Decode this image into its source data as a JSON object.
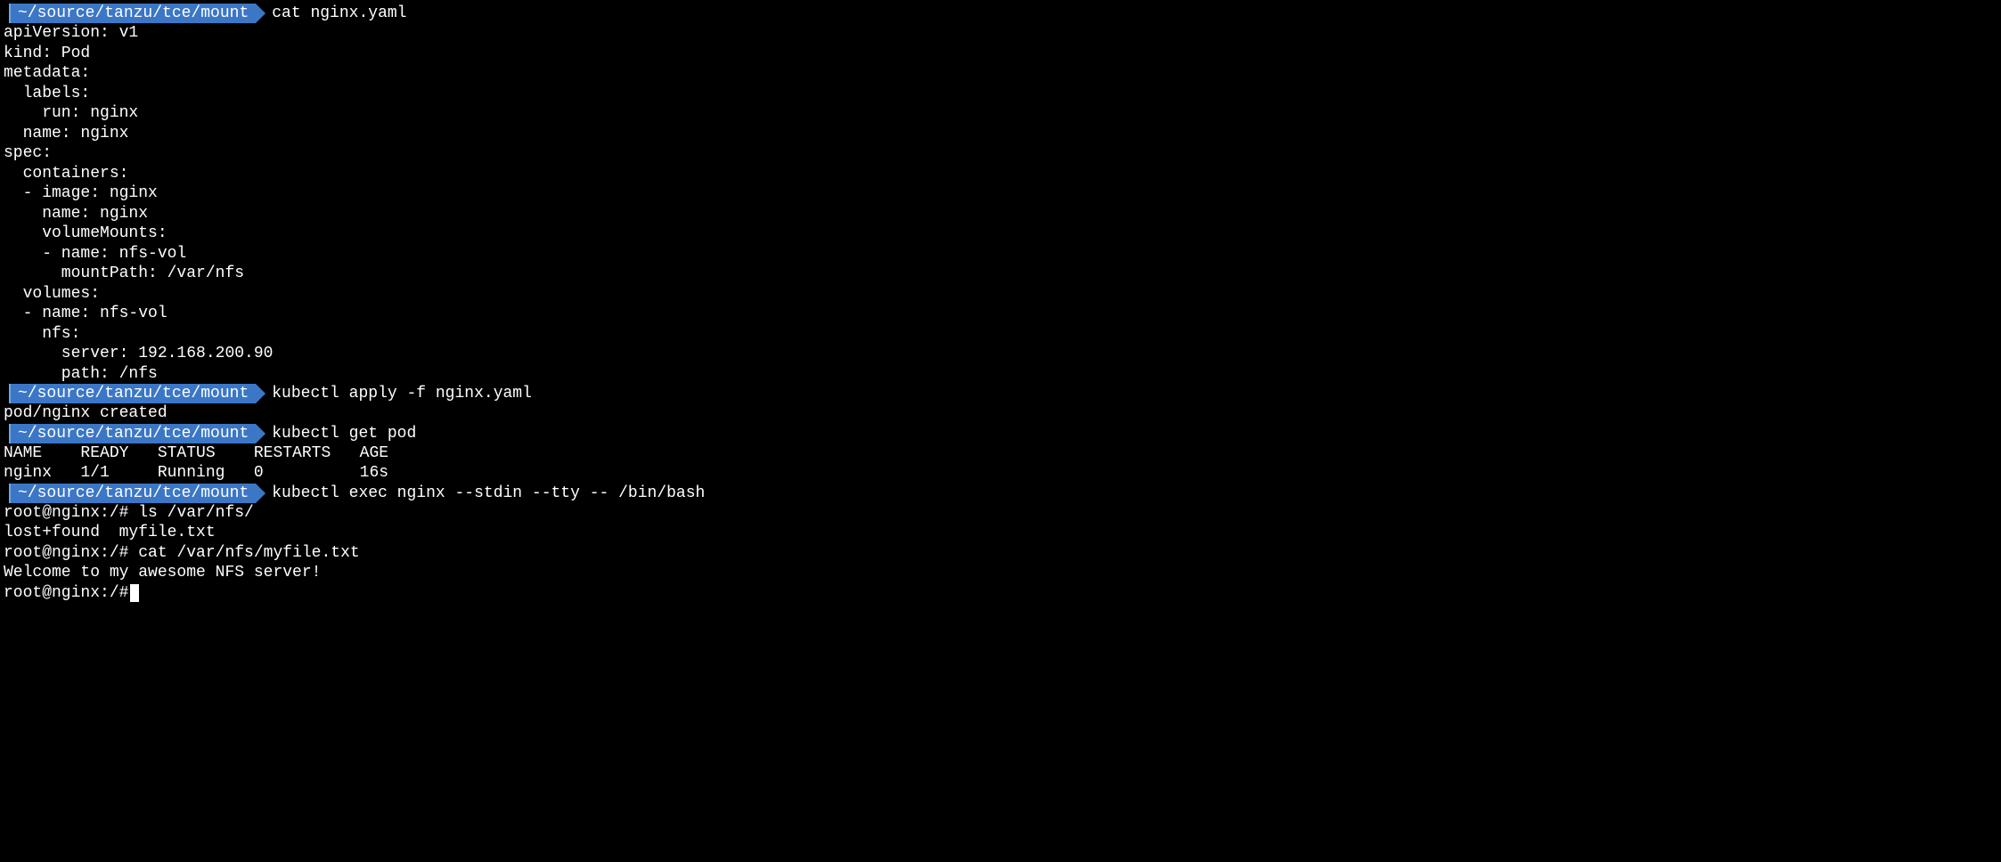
{
  "entries": [
    {
      "type": "prompt",
      "cwd": "~/source/tanzu/tce/mount",
      "command": "cat nginx.yaml"
    },
    {
      "type": "output",
      "lines": [
        "apiVersion: v1",
        "kind: Pod",
        "metadata:",
        "  labels:",
        "    run: nginx",
        "  name: nginx",
        "spec:",
        "  containers:",
        "  - image: nginx",
        "    name: nginx",
        "    volumeMounts:",
        "    - name: nfs-vol",
        "      mountPath: /var/nfs",
        "  volumes:",
        "  - name: nfs-vol",
        "    nfs:",
        "      server: 192.168.200.90",
        "      path: /nfs"
      ]
    },
    {
      "type": "prompt",
      "cwd": "~/source/tanzu/tce/mount",
      "command": "kubectl apply -f nginx.yaml"
    },
    {
      "type": "output",
      "lines": [
        "pod/nginx created"
      ]
    },
    {
      "type": "prompt",
      "cwd": "~/source/tanzu/tce/mount",
      "command": "kubectl get pod"
    },
    {
      "type": "output",
      "lines": [
        "NAME    READY   STATUS    RESTARTS   AGE",
        "nginx   1/1     Running   0          16s"
      ]
    },
    {
      "type": "prompt",
      "cwd": "~/source/tanzu/tce/mount",
      "command": "kubectl exec nginx --stdin --tty -- /bin/bash"
    },
    {
      "type": "bash",
      "prompt": "root@nginx:/#",
      "command": "ls /var/nfs/"
    },
    {
      "type": "output",
      "lines": [
        "lost+found  myfile.txt"
      ]
    },
    {
      "type": "bash",
      "prompt": "root@nginx:/#",
      "command": "cat /var/nfs/myfile.txt"
    },
    {
      "type": "output",
      "lines": [
        "Welcome to my awesome NFS server!"
      ]
    },
    {
      "type": "bash-cursor",
      "prompt": "root@nginx:/#"
    }
  ]
}
